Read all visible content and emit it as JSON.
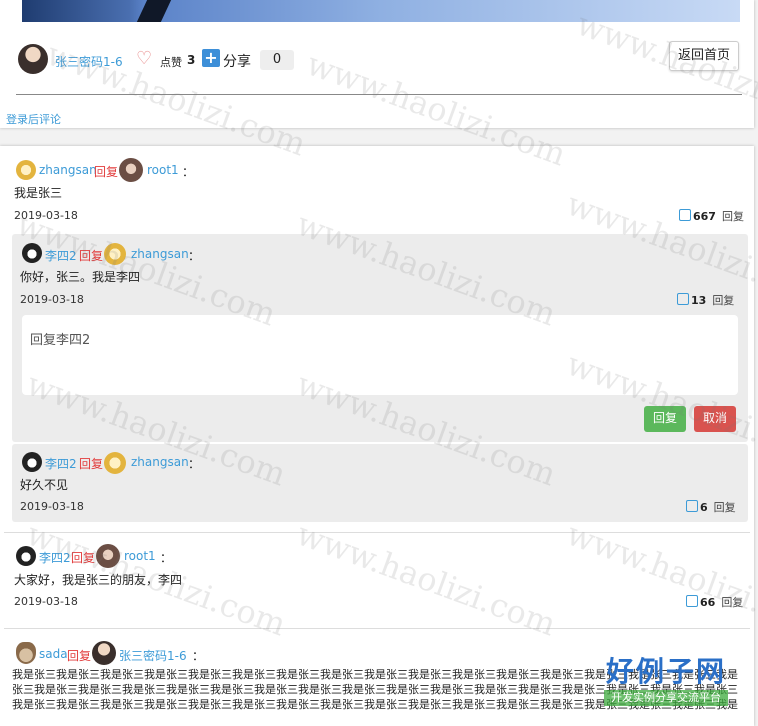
{
  "post": {
    "author": "张三密码1-6",
    "like_label": "点赞",
    "like_count": "3",
    "share_label": "分享",
    "share_count": "0",
    "back_button": "返回首页",
    "login_prompt": "登录后评论"
  },
  "reply_word": "回复",
  "reply_link": "回复",
  "comments": [
    {
      "from": "zhangsan",
      "to": "root1",
      "colon": "：",
      "text": "我是张三",
      "date": "2019-03-18",
      "likes": "667"
    },
    {
      "from": "李四2",
      "to": "zhangsan",
      "colon": "：",
      "text": "你好，张三。我是李四",
      "date": "2019-03-18",
      "likes": "13"
    },
    {
      "from": "李四2",
      "to": "zhangsan",
      "colon": "：",
      "text": "好久不见",
      "date": "2019-03-18",
      "likes": "6"
    },
    {
      "from": "李四2",
      "to": "root1",
      "colon": "：",
      "text": "大家好，我是张三的朋友，李四",
      "date": "2019-03-18",
      "likes": "66"
    },
    {
      "from": "sada",
      "to": "张三密码1-6",
      "colon": "：",
      "text": "我是张三我是张三我是张三我是张三我是张三我是张三我是张三我是张三我是张三我是张三我是张三我是张三我是张三我是张三我是张三我是张三我是张三我是张三我是张三我是张三我是张三我是张三我是张三我是张三我是张三我是张三我是张三我是张三我是张三我是张三我是张三我是张三我是张三我是张三我是张三我是张三我是张三我是张三我是张三我是张三我是张三我是张三我是张三我是张三我是张三我是张三我是张三我是张三我是张三我是张三我是张三我是张三我是张三我是张三我是张三我是张三我是张三我是张三我是张三我是张三我是张三我是张三我是张三我是张三"
    }
  ],
  "reply_box": {
    "value": "回复李四2",
    "submit": "回复",
    "cancel": "取消"
  },
  "watermark": "www.haolizi.com",
  "logo": {
    "title": "好例子网",
    "subtitle": "开发实例分享交流平台"
  },
  "colors": {
    "link": "#3d9bd7",
    "reply_word": "#e23c3c",
    "submit": "#5cb85c",
    "cancel": "#d9534f",
    "like_heart": "#e88a8a",
    "share_plus": "#3d8fd8"
  }
}
